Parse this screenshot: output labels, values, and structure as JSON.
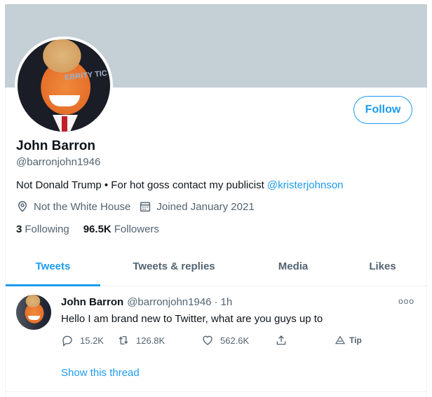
{
  "profile": {
    "name": "John Barron",
    "handle": "@barronjohn1946",
    "bio_text": "Not Donald Trump • For hot goss contact my publicist ",
    "bio_mention": "@kristerjohnson",
    "location": "Not the White House",
    "joined": "Joined January 2021",
    "following_count": "3",
    "following_label": "Following",
    "followers_count": "96.5K",
    "followers_label": "Followers",
    "follow_button": "Follow",
    "avatar_backdrop_text": "EBRITY TIC"
  },
  "tabs": [
    {
      "label": "Tweets",
      "active": true
    },
    {
      "label": "Tweets & replies",
      "active": false
    },
    {
      "label": "Media",
      "active": false
    },
    {
      "label": "Likes",
      "active": false
    }
  ],
  "tweet": {
    "name": "John Barron",
    "handle": "@barronjohn1946",
    "separator": "·",
    "time": "1h",
    "more": "ooo",
    "text": "Hello I am brand new to Twitter, what are you guys up to",
    "replies": "15.2K",
    "retweets": "126.8K",
    "likes": "562.6K",
    "tip_label": "Tip",
    "show_thread": "Show this thread"
  },
  "icons": {
    "location": "location-pin-icon",
    "calendar": "calendar-icon",
    "reply": "reply-icon",
    "retweet": "retweet-icon",
    "like": "heart-icon",
    "share": "share-icon",
    "tip": "tip-icon",
    "more": "more-icon"
  },
  "colors": {
    "accent": "#1d9bf0",
    "banner": "#c4cfd6",
    "secondary_text": "#536471",
    "primary_text": "#0f1419"
  }
}
